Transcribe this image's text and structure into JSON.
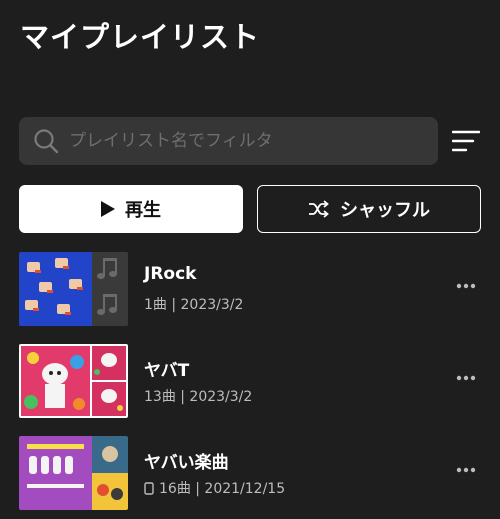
{
  "header": {
    "title": "マイプレイリスト"
  },
  "search": {
    "placeholder": "プレイリスト名でフィルタ",
    "value": ""
  },
  "actions": {
    "play_label": "再生",
    "shuffle_label": "シャッフル"
  },
  "playlists": [
    {
      "name": "JRock",
      "meta": "1曲 | 2023/3/2",
      "downloaded": false
    },
    {
      "name": "ヤバT",
      "meta": "13曲 | 2023/3/2",
      "downloaded": false
    },
    {
      "name": "ヤバい楽曲",
      "meta": "16曲 | 2021/12/15",
      "downloaded": true
    }
  ],
  "icons": [
    "search-icon",
    "sort-icon",
    "play-icon",
    "shuffle-icon",
    "more-icon",
    "phone-icon",
    "music-note-icon"
  ],
  "colors": {
    "background": "#1e1e1e",
    "search_bg": "#363636",
    "meta_text": "#bdbdbd"
  }
}
